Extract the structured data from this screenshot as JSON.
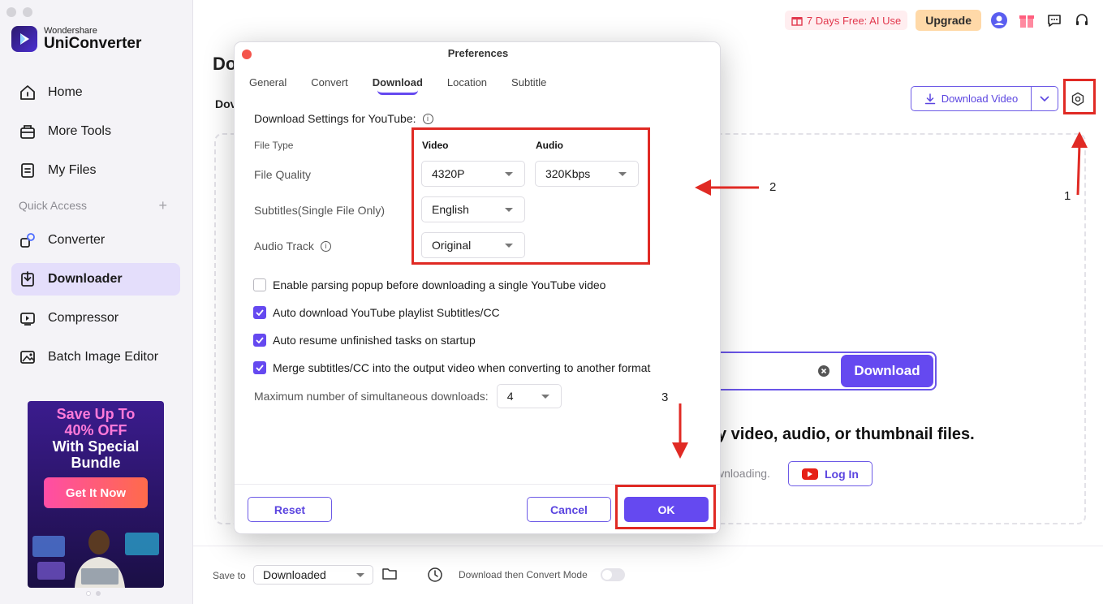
{
  "app": {
    "brand_small": "Wondershare",
    "brand_big": "UniConverter"
  },
  "sidebar": {
    "items": [
      {
        "label": "Home",
        "icon": "home-icon"
      },
      {
        "label": "More Tools",
        "icon": "toolbox-icon"
      },
      {
        "label": "My Files",
        "icon": "file-icon"
      }
    ],
    "quick_access_label": "Quick Access",
    "quick_items": [
      {
        "label": "Converter",
        "icon": "converter-icon"
      },
      {
        "label": "Downloader",
        "icon": "downloader-icon",
        "active": true
      },
      {
        "label": "Compressor",
        "icon": "compressor-icon"
      },
      {
        "label": "Batch Image Editor",
        "icon": "image-editor-icon"
      }
    ],
    "promo": {
      "line1": "Save Up To",
      "line2": "40% OFF",
      "line3": "With Special",
      "line4": "Bundle",
      "button": "Get It Now"
    }
  },
  "topbar": {
    "trial": "7 Days Free: AI Use",
    "upgrade": "Upgrade"
  },
  "main": {
    "title": "Do",
    "subtitle": "Dov",
    "download_video_button": "Download Video",
    "download_button": "Download",
    "hint": "y video, audio, or thumbnail files.",
    "login_hint": "wnloading.",
    "login_button": "Log In"
  },
  "bottom": {
    "save_to_label": "Save to",
    "save_to_value": "Downloaded",
    "mode_label": "Download then Convert Mode"
  },
  "dialog": {
    "title": "Preferences",
    "tabs": [
      "General",
      "Convert",
      "Download",
      "Location",
      "Subtitle"
    ],
    "active_tab": "Download",
    "heading": "Download Settings for YouTube:",
    "file_type_label": "File Type",
    "video_col": "Video",
    "audio_col": "Audio",
    "file_quality_label": "File Quality",
    "video_quality": "4320P",
    "audio_quality": "320Kbps",
    "subtitles_label": "Subtitles(Single File Only)",
    "subtitles_value": "English",
    "audio_track_label": "Audio Track",
    "audio_track_value": "Original",
    "checkboxes": [
      {
        "label": "Enable parsing popup before downloading a single YouTube video",
        "checked": false
      },
      {
        "label": "Auto download YouTube playlist Subtitles/CC",
        "checked": true
      },
      {
        "label": "Auto resume unfinished tasks on startup",
        "checked": true
      },
      {
        "label": "Merge subtitles/CC into the output video when converting to another format",
        "checked": true
      }
    ],
    "max_downloads_label": "Maximum number of simultaneous downloads:",
    "max_downloads_value": "4",
    "reset": "Reset",
    "cancel": "Cancel",
    "ok": "OK"
  },
  "annotations": {
    "n1": "1",
    "n2": "2",
    "n3": "3",
    "color": "#e02a24"
  },
  "colors": {
    "accent": "#6549f0",
    "sidebar_bg": "#f4f3f7",
    "active_item_bg": "#e4defb"
  }
}
